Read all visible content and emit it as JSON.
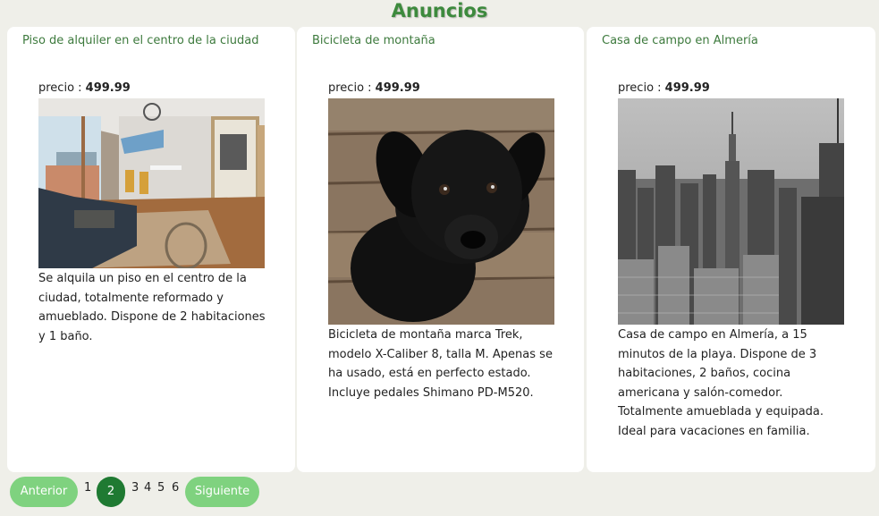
{
  "page": {
    "title": "Anuncios"
  },
  "listings": [
    {
      "title": "Piso de alquiler en el centro de la ciudad",
      "price_label": "precio : ",
      "price": "499.99",
      "image": "living-room-photo",
      "description": "Se alquila un piso en el centro de la ciudad, totalmente reformado y amueblado. Dispone de 2 habitaciones y 1 baño."
    },
    {
      "title": "Bicicleta de montaña",
      "price_label": "precio : ",
      "price": "499.99",
      "image": "black-puppy-photo",
      "description": "Bicicleta de montaña marca Trek, modelo X-Caliber 8, talla M. Apenas se ha usado, está en perfecto estado. Incluye pedales Shimano PD-M520."
    },
    {
      "title": "Casa de campo en Almería",
      "price_label": "precio : ",
      "price": "499.99",
      "image": "city-skyline-photo",
      "description": "Casa de campo en Almería, a 15 minutos de la playa. Dispone de 3 habitaciones, 2 baños, cocina americana y salón-comedor. Totalmente amueblada y equipada. Ideal para vacaciones en familia."
    }
  ],
  "pagination": {
    "prev_label": "Anterior",
    "next_label": "Siguiente",
    "pages": [
      "1",
      "2",
      "3",
      "4",
      "5",
      "6"
    ],
    "current": "2"
  },
  "colors": {
    "title_green": "#3d8a3d",
    "button_green": "#7fd27f",
    "active_page_green": "#1f7a32",
    "background": "#efefe9"
  }
}
